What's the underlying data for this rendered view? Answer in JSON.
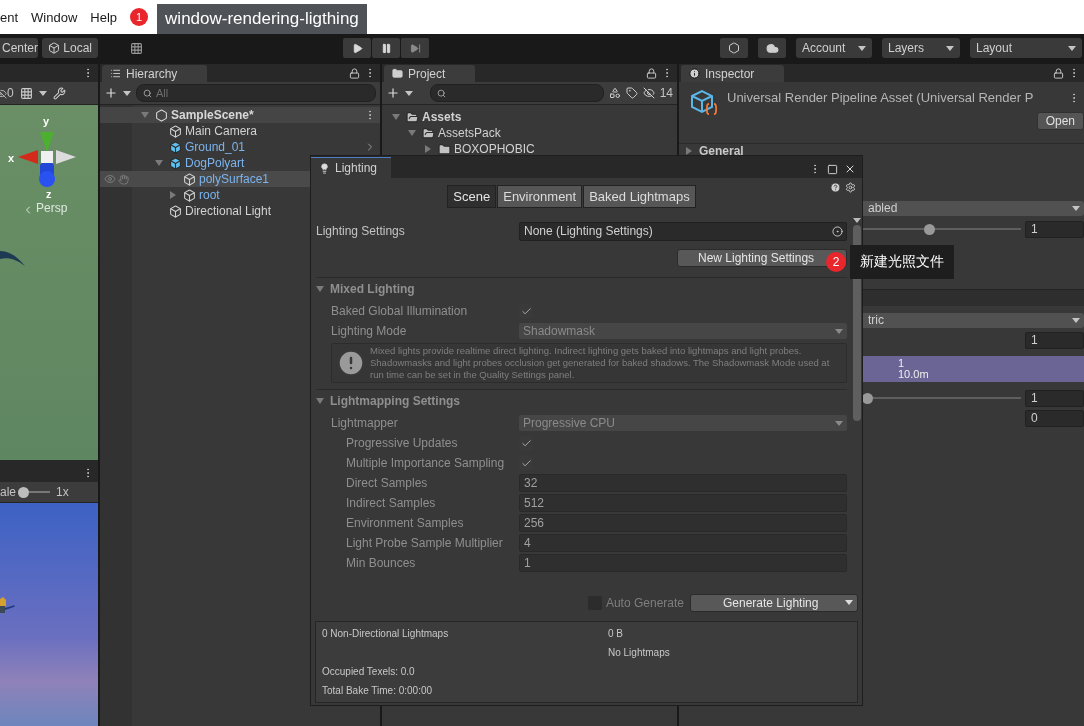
{
  "menu": [
    "ent",
    "Window",
    "Help"
  ],
  "annotations": [
    {
      "number": "1",
      "text": "window-rendering-ligthing"
    },
    {
      "number": "2",
      "text": "新建光照文件"
    }
  ],
  "toolbar": {
    "pivot": "Center",
    "space": "Local",
    "account": "Account",
    "layers": "Layers",
    "layout": "Layout"
  },
  "scene_view": {
    "hidden_count": "0",
    "axes": {
      "y": "y",
      "x": "x",
      "z": "z"
    },
    "projection": "Persp"
  },
  "game_view": {
    "scale_label": "ale",
    "scale": "1x",
    "level": 0.05
  },
  "hierarchy": {
    "title": "Hierarchy",
    "search_placeholder": "All",
    "tree": [
      {
        "label": "SampleScene*",
        "kind": "scene",
        "selected": false,
        "expanded": true,
        "children": [
          {
            "label": "Main Camera",
            "kind": "object",
            "selected": false
          },
          {
            "label": "Ground_01",
            "kind": "prefab",
            "selected": false,
            "open_arrow": true
          },
          {
            "label": "DogPolyart",
            "kind": "prefab",
            "selected": false,
            "expanded": true,
            "children": [
              {
                "label": "polySurface1",
                "kind": "prefab_child",
                "selected": true
              },
              {
                "label": "root",
                "kind": "prefab_child",
                "selected": false,
                "expanded": false
              }
            ]
          },
          {
            "label": "Directional Light",
            "kind": "object",
            "selected": false
          }
        ]
      }
    ]
  },
  "project": {
    "title": "Project",
    "hidden_count": "14",
    "tree": [
      {
        "label": "Assets",
        "expanded": true,
        "children": [
          {
            "label": "AssetsPack",
            "expanded": true,
            "children": [
              {
                "label": "BOXOPHOBIC",
                "expanded": false
              }
            ]
          }
        ]
      }
    ]
  },
  "inspector": {
    "title": "Inspector",
    "asset_title": "Universal Render Pipeline Asset (Universal Render P",
    "open_button": "Open",
    "section": "General",
    "rows": [
      {
        "kind": "dropdown",
        "value": "abled"
      },
      {
        "kind": "slider",
        "level": 0.45,
        "value": "1"
      },
      {
        "kind": "header"
      },
      {
        "kind": "dropdown",
        "value": "tric"
      },
      {
        "kind": "field",
        "value": "1"
      },
      {
        "kind": "bar",
        "values": [
          "1",
          "10.0m"
        ]
      },
      {
        "kind": "slider",
        "level": 0.08,
        "value": "1"
      },
      {
        "kind": "field",
        "value": "0"
      }
    ]
  },
  "lighting": {
    "title": "Lighting",
    "tabs": [
      {
        "label": "Scene",
        "selected": true
      },
      {
        "label": "Environment",
        "selected": false
      },
      {
        "label": "Baked Lightmaps",
        "selected": false
      }
    ],
    "settings_label": "Lighting Settings",
    "settings_value": "None (Lighting Settings)",
    "new_button": "New Lighting Settings",
    "sections": [
      {
        "title": "Mixed Lighting",
        "expanded": true,
        "rows": [
          {
            "kind": "checkbox",
            "label": "Baked Global Illumination",
            "checked": true
          },
          {
            "kind": "dropdown",
            "label": "Lighting Mode",
            "value": "Shadowmask"
          },
          {
            "kind": "help",
            "text": "Mixed lights provide realtime direct lighting. Indirect lighting gets baked into lightmaps and light probes. Shadowmasks and light probes occlusion get generated for baked shadows. The Shadowmask Mode used at run time can be set in the Quality Settings panel."
          }
        ]
      },
      {
        "title": "Lightmapping Settings",
        "expanded": true,
        "rows": [
          {
            "kind": "dropdown",
            "label": "Lightmapper",
            "value": "Progressive CPU",
            "children": [
              {
                "kind": "checkbox",
                "label": "Progressive Updates",
                "checked": true
              },
              {
                "kind": "checkbox",
                "label": "Multiple Importance Sampling",
                "checked": true
              },
              {
                "kind": "field",
                "label": "Direct Samples",
                "value": "32"
              },
              {
                "kind": "field",
                "label": "Indirect Samples",
                "value": "512"
              },
              {
                "kind": "field",
                "label": "Environment Samples",
                "value": "256"
              },
              {
                "kind": "field",
                "label": "Light Probe Sample Multiplier",
                "value": "4"
              },
              {
                "kind": "field",
                "label": "Min Bounces",
                "value": "1"
              }
            ]
          }
        ]
      }
    ],
    "auto_generate": {
      "label": "Auto Generate",
      "checked": false
    },
    "generate_button": "Generate Lighting",
    "stats": {
      "lightmaps": "0 Non-Directional Lightmaps",
      "size": "0 B",
      "status": "No Lightmaps",
      "texels": "Occupied Texels: 0.0",
      "bake_time": "Total Bake Time: 0:00:00"
    }
  }
}
